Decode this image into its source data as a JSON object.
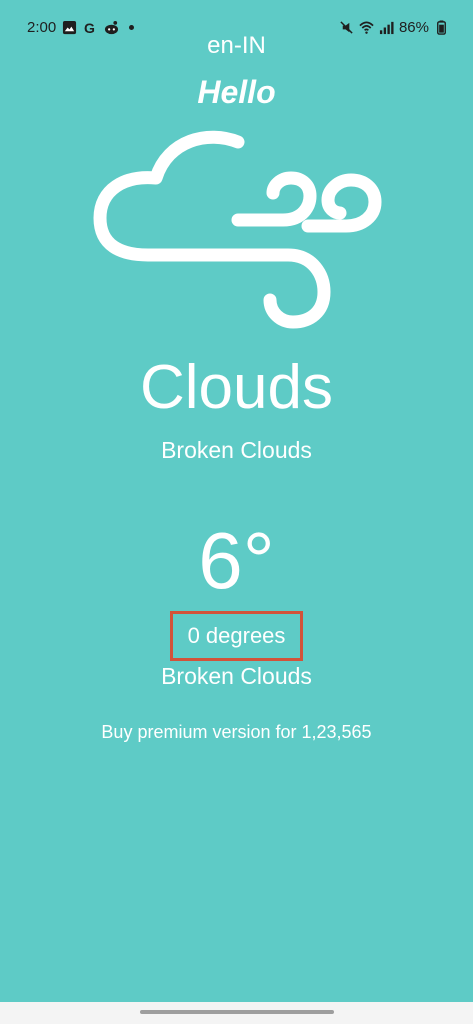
{
  "status_bar": {
    "time": "2:00",
    "battery": "86%",
    "left_icons": [
      "image-icon",
      "google-icon",
      "reddit-icon",
      "dot-icon"
    ],
    "right_icons": [
      "mute-icon",
      "wifi-icon",
      "signal-icon",
      "battery-icon"
    ]
  },
  "locale": "en-IN",
  "greeting": "Hello",
  "weather": {
    "icon": "cloud-wind-icon",
    "condition": "Clouds",
    "description": "Broken Clouds",
    "temperature": "6°",
    "degrees_text": "0 degrees",
    "description_2": "Broken Clouds"
  },
  "premium_text": "Buy premium version for 1,23,565",
  "colors": {
    "background": "#5ecbc6",
    "text": "#ffffff",
    "highlight_border": "#d2533a"
  }
}
